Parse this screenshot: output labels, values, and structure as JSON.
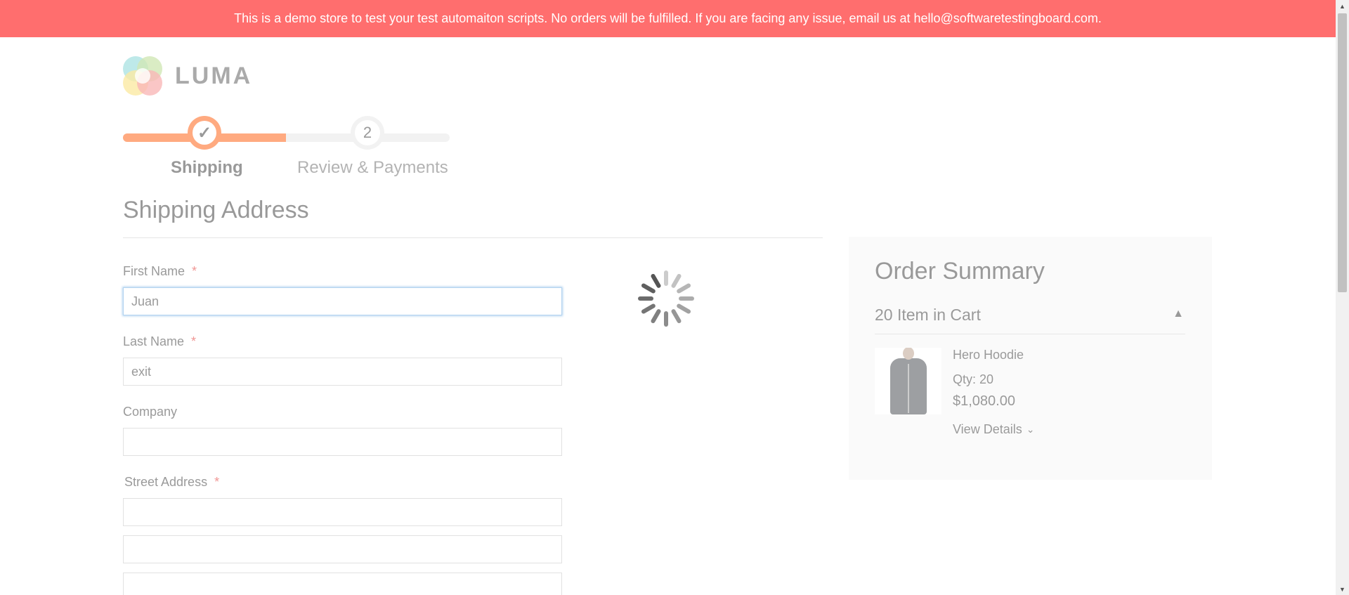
{
  "notice": {
    "text": "This is a demo store to test your test automaiton scripts. No orders will be fulfilled. If you are facing any issue, email us at hello@softwaretestingboard.com."
  },
  "logo": {
    "text": "LUMA"
  },
  "progress": {
    "steps": [
      {
        "label": "Shipping",
        "marker": "✓",
        "state": "active"
      },
      {
        "label": "Review & Payments",
        "marker": "2",
        "state": "pending"
      }
    ]
  },
  "shipping": {
    "title": "Shipping Address",
    "required_marker": "*",
    "first_name": {
      "label": "First Name",
      "value": "Juan"
    },
    "last_name": {
      "label": "Last Name",
      "value": "exit"
    },
    "company": {
      "label": "Company",
      "value": ""
    },
    "street": {
      "label": "Street Address",
      "line1": "",
      "line2": "",
      "line3": ""
    }
  },
  "summary": {
    "title": "Order Summary",
    "cart_count": "20 Item in Cart",
    "item": {
      "name": "Hero Hoodie",
      "qty": "Qty: 20",
      "price": "$1,080.00",
      "view_details": "View Details"
    }
  },
  "colors": {
    "notice_bg": "#ff6e6e",
    "progress_accent": "#ff5501",
    "required": "#e02b27",
    "focus": "#68a8e0"
  },
  "icons": {
    "step1": "checkmark-icon",
    "collapse": "chevron-up-icon",
    "view_details": "chevron-down-icon",
    "loading": "spinner-icon"
  }
}
